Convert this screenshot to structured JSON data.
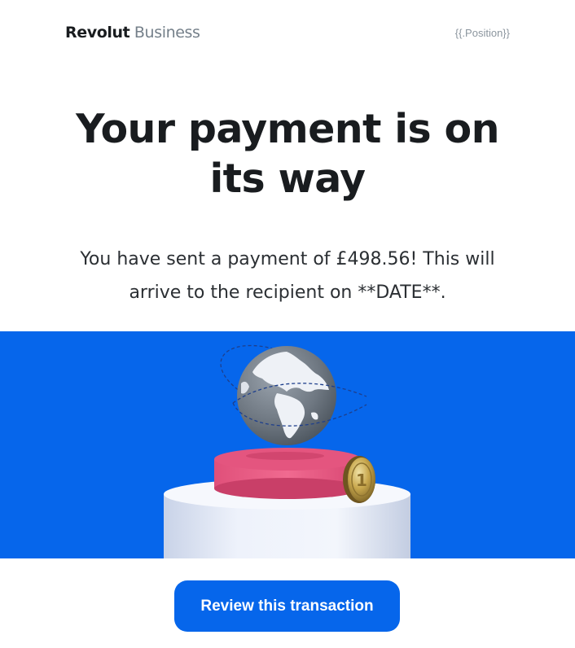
{
  "header": {
    "brand_name": "Revolut",
    "product_name": "Business",
    "position_placeholder": "{{.Position}}"
  },
  "headline": "Your payment is on its way",
  "body_text": "You have sent a payment of £498.56! This will arrive to the recipient on **DATE**.",
  "hero": {
    "background_color": "#0666eb",
    "elements": [
      "globe-illustration",
      "pedestal",
      "gold-coin"
    ],
    "coin_label": "1"
  },
  "cta": {
    "label": "Review this transaction",
    "color": "#0666eb"
  }
}
